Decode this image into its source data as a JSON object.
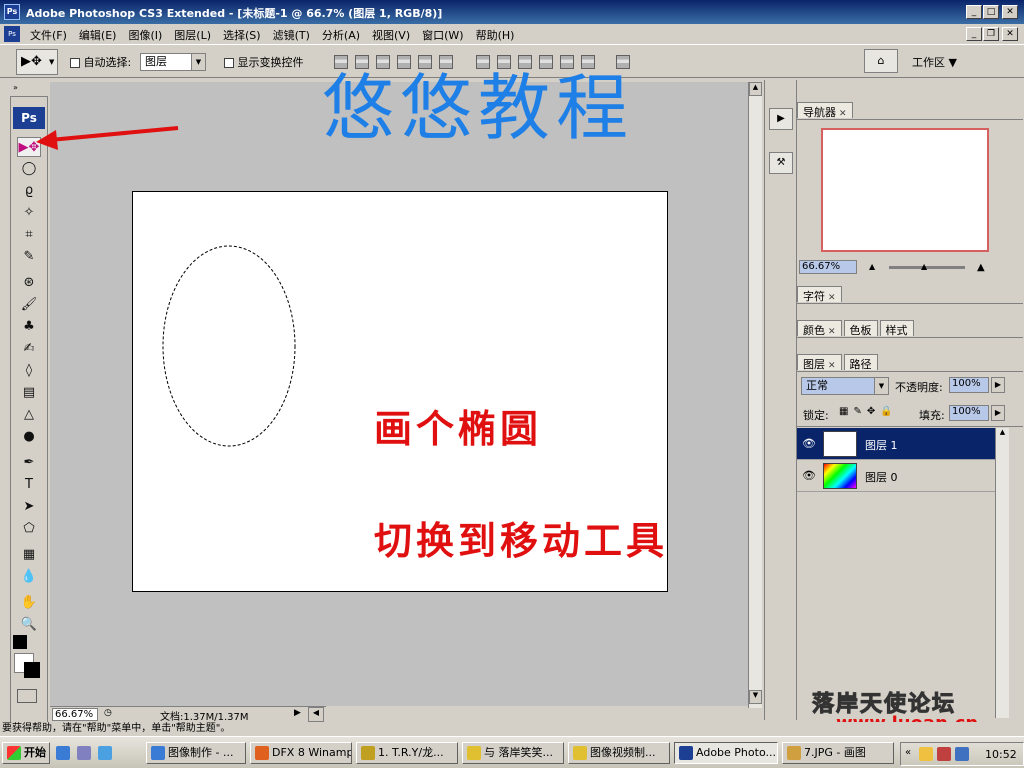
{
  "window": {
    "title": "Adobe Photoshop CS3 Extended - [未标题-1 @ 66.7% (图层 1, RGB/8)]",
    "app_icon": "Ps"
  },
  "menu": [
    "文件(F)",
    "编辑(E)",
    "图像(I)",
    "图层(L)",
    "选择(S)",
    "滤镜(T)",
    "分析(A)",
    "视图(V)",
    "窗口(W)",
    "帮助(H)"
  ],
  "options": {
    "auto_select_label": "自动选择:",
    "auto_select_value": "图层",
    "show_transform_label": "显示变换控件",
    "workspace_label": "工作区 ▼"
  },
  "toolbox": {
    "logo": "Ps",
    "tools": [
      "move-tool-icon",
      "marquee-tool-icon",
      "lasso-tool-icon",
      "magic-wand-icon",
      "crop-tool-icon",
      "slice-tool-icon",
      "healing-brush-icon",
      "brush-tool-icon",
      "clone-stamp-icon",
      "history-brush-icon",
      "eraser-icon",
      "gradient-tool-icon",
      "blur-tool-icon",
      "dodge-tool-icon",
      "pen-tool-icon",
      "type-tool-icon",
      "path-selection-icon",
      "shape-tool-icon",
      "notes-icon",
      "eyedropper-icon",
      "hand-tool-icon",
      "zoom-tool-icon"
    ],
    "tool_glyphs": [
      "▶✥",
      "◯",
      "ϱ",
      "✧",
      "⌗",
      "✎",
      "⊛",
      "🖌",
      "♣",
      "✍",
      "◊",
      "▤",
      "△",
      "●",
      "✒",
      "T",
      "➤",
      "⬠",
      "▦",
      "💧",
      "✋",
      "🔍"
    ]
  },
  "overlay": {
    "heading": "悠悠教程",
    "note1": "画个椭圆",
    "note2": "切换到移动工具",
    "arrow_color": "#e01010",
    "heading_color": "#1e7fe6",
    "note_color": "#e01010"
  },
  "status": {
    "zoom": "66.67%",
    "doc": "文档:1.37M/1.37M"
  },
  "panels": {
    "navigator_tab": "导航器",
    "navigator_zoom": "66.67%",
    "character_tab": "字符",
    "color_tab": "颜色",
    "swatches_tab": "色板",
    "styles_tab": "样式",
    "layers_tab": "图层",
    "paths_tab": "路径",
    "blend_mode": "正常",
    "opacity_label": "不透明度:",
    "opacity_value": "100%",
    "lock_label": "锁定:",
    "fill_label": "填充:",
    "fill_value": "100%",
    "layers": [
      {
        "name": "图层 1",
        "selected": true
      },
      {
        "name": "图层 0",
        "selected": false
      }
    ]
  },
  "hint": "要获得帮助，请在\"帮助\"菜单中，单击\"帮助主题\"。",
  "taskbar": {
    "start": "开始",
    "items": [
      "图像制作 - ...",
      "DFX 8 Winamp",
      "1. T.R.Y/龙...",
      "与 落岸笑笑...",
      "图像视频制...",
      "Adobe Photo...",
      "7.JPG - 画图"
    ],
    "clock": "10:52"
  },
  "watermark": {
    "site": "www.luoan.cn",
    "forum": "落岸天使论坛"
  }
}
